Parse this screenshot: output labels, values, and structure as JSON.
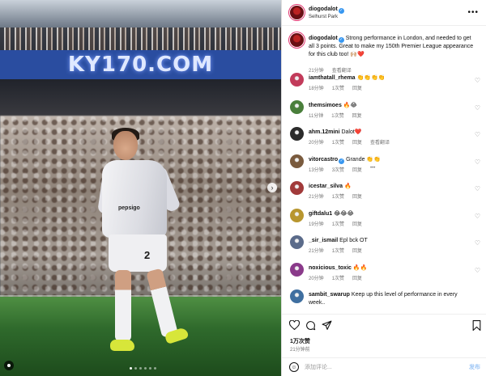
{
  "photo": {
    "banner_text": "KY170.COM",
    "jersey_sponsor": "pepsigo",
    "shorts_number": "2",
    "next_icon": "chevron-right-icon",
    "dots": 6,
    "active_dot": 0
  },
  "post": {
    "author": "diogodalot",
    "location": "Selhurst Park",
    "verified": true,
    "more_icon": "more-horizontal-icon",
    "caption": "Strong performance in London, and needed to get all 3 points. Great to make my 150th Premier League appearance for this club too! 🙌🏼❤️",
    "caption_time": "21分钟",
    "caption_translate": "查看翻译"
  },
  "comments": [
    {
      "user": "iamthatall_rhema",
      "verified": false,
      "text": "👏👏👏👏",
      "time": "18分钟",
      "likes": "1次赞",
      "reply": "回复",
      "translate": ""
    },
    {
      "user": "themsimoes",
      "verified": false,
      "text": "🔥😂",
      "time": "11分钟",
      "likes": "1次赞",
      "reply": "回复",
      "translate": ""
    },
    {
      "user": "ahm.12mini",
      "verified": false,
      "text": "Dalot❤️",
      "time": "20分钟",
      "likes": "1次赞",
      "reply": "回复",
      "translate": "查看翻译"
    },
    {
      "user": "vitorcastro",
      "verified": true,
      "text": "Grande 👏👏",
      "time": "13分钟",
      "likes": "3次赞",
      "reply": "回复",
      "translate": "•••"
    },
    {
      "user": "icestar_silva",
      "verified": false,
      "text": "🔥",
      "time": "21分钟",
      "likes": "1次赞",
      "reply": "回复",
      "translate": ""
    },
    {
      "user": "giftdalu1",
      "verified": false,
      "text": "😂😂😂",
      "time": "19分钟",
      "likes": "1次赞",
      "reply": "回复",
      "translate": ""
    },
    {
      "user": "_sir_ismail",
      "verified": false,
      "text": "Epl bck OT",
      "time": "21分钟",
      "likes": "1次赞",
      "reply": "回复",
      "translate": ""
    },
    {
      "user": "noxicious_toxic",
      "verified": false,
      "text": "🔥🔥",
      "time": "20分钟",
      "likes": "1次赞",
      "reply": "回复",
      "translate": ""
    },
    {
      "user": "sambit_swarup",
      "verified": false,
      "text": "Keep up this level of performance in every week..",
      "time": "",
      "likes": "",
      "reply": "",
      "translate": ""
    }
  ],
  "actions": {
    "like_icon": "heart-icon",
    "comment_icon": "comment-icon",
    "share_icon": "send-icon",
    "save_icon": "bookmark-icon",
    "likes_count": "1万次赞",
    "post_time": "21分钟前"
  },
  "add_comment": {
    "emoji_icon": "emoji-icon",
    "placeholder": "添加评论...",
    "post_label": "发布"
  },
  "colors": {
    "verified_blue": "#3897f0",
    "story_ring": "#e1306c",
    "boot_yellow": "#d7e63a",
    "banner_blue": "#2a4da0"
  }
}
